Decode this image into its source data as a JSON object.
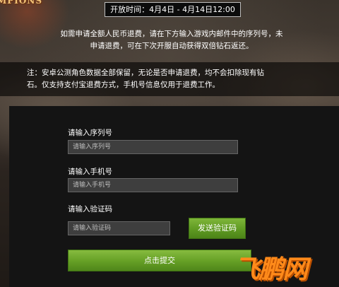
{
  "header": {
    "logo_text": "MPIONS",
    "period": "开放时间：4月4日 - 4月14日12:00"
  },
  "notices": {
    "refund_line1": "如需申请全额人民币退费，请在下方输入游戏内邮件中的序列号，未",
    "refund_line2": "申请退费，可在下次开服自动获得双倍钻石返还。",
    "note_line1": "注：安卓公测角色数据全部保留，无论是否申请退费，均不会扣除现有钻",
    "note_line2": "石。仅支持支付宝退费方式，手机号信息仅用于退费工作。"
  },
  "form": {
    "serial_label": "请输入序列号",
    "serial_placeholder": "请输入序列号",
    "phone_label": "请输入手机号",
    "phone_placeholder": "请输入手机号",
    "code_label": "请输入验证码",
    "code_placeholder": "请输入验证码",
    "send_code_button": "发送验证码",
    "submit_button": "点击提交"
  },
  "watermark": "飞鹏网"
}
